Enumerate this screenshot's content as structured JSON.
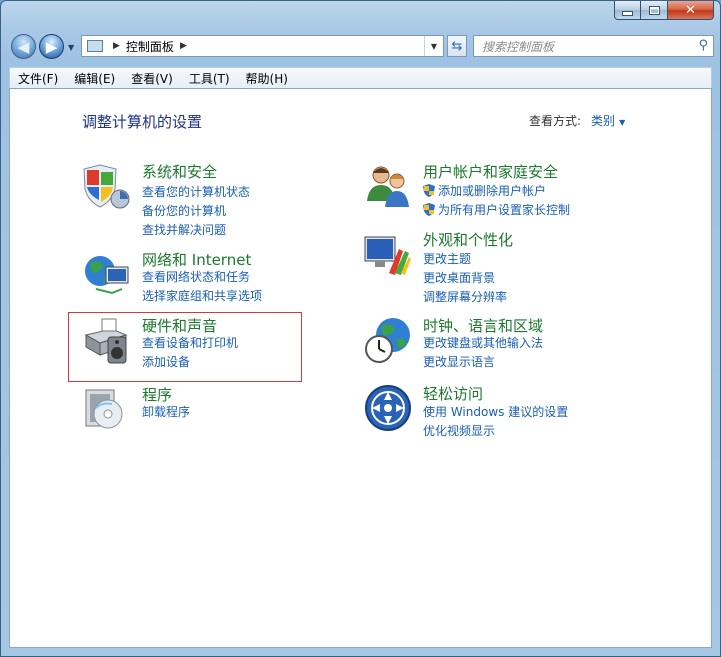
{
  "breadcrumb": {
    "location": "控制面板"
  },
  "search": {
    "placeholder": "搜索控制面板"
  },
  "menu": {
    "items": [
      "文件(F)",
      "编辑(E)",
      "查看(V)",
      "工具(T)",
      "帮助(H)"
    ]
  },
  "page": {
    "title": "调整计算机的设置",
    "view_by_label": "查看方式:",
    "view_by_value": "类别"
  },
  "categories": [
    {
      "title": "系统和安全",
      "links": [
        "查看您的计算机状态",
        "备份您的计算机",
        "查找并解决问题"
      ],
      "icon": "shield-security-icon"
    },
    {
      "title": "网络和 Internet",
      "links": [
        "查看网络状态和任务",
        "选择家庭组和共享选项"
      ],
      "icon": "network-globe-icon"
    },
    {
      "title": "硬件和声音",
      "links": [
        "查看设备和打印机",
        "添加设备"
      ],
      "icon": "printer-speaker-icon"
    },
    {
      "title": "程序",
      "links": [
        "卸载程序"
      ],
      "icon": "programs-disc-icon"
    },
    {
      "title": "用户帐户和家庭安全",
      "links": [
        "添加或删除用户帐户",
        "为所有用户设置家长控制"
      ],
      "icon": "users-icon"
    },
    {
      "title": "外观和个性化",
      "links": [
        "更改主题",
        "更改桌面背景",
        "调整屏幕分辨率"
      ],
      "icon": "monitor-palette-icon"
    },
    {
      "title": "时钟、语言和区域",
      "links": [
        "更改键盘或其他输入法",
        "更改显示语言"
      ],
      "icon": "clock-globe-icon"
    },
    {
      "title": "轻松访问",
      "links": [
        "使用 Windows 建议的设置",
        "优化视频显示"
      ],
      "icon": "ease-of-access-icon"
    }
  ],
  "colors": {
    "category_title": "#1b7a2e",
    "link": "#1a5fb4",
    "page_title": "#1e3287",
    "selection_border": "#d23a3a"
  }
}
